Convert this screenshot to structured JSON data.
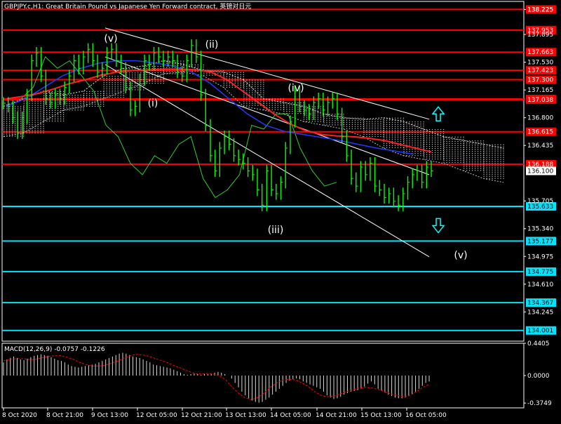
{
  "header": {
    "title": "GBPJPY.c,H1:  Great Britain Pound vs Japanese Yen Forward contract, 英镑对日元"
  },
  "macd": {
    "label": "MACD(12,26,9) -0.0757 -0.1226",
    "ticks": [
      "0.4405",
      "0.0000",
      "-0.3749"
    ]
  },
  "colors": {
    "background": "#000000",
    "price_bars": "#00ff00",
    "resistance": "#ff0000",
    "support": "#00e5ff",
    "ma_red": "#ff2020",
    "ma_blue": "#1e3cff",
    "chikou": "#33cc33",
    "channel": "#ffffff",
    "text": "#ffffff",
    "arrow": "#00ffff"
  },
  "chart_data": [
    {
      "type": "line",
      "title": "GBPJPY.c,H1:  Great Britain Pound vs Japanese Yen Forward contract, 英镑对日元",
      "x_ticks": [
        "8 Oct 2020",
        "8 Oct 21:00",
        "9 Oct 13:00",
        "12 Oct 05:00",
        "12 Oct 21:00",
        "13 Oct 13:00",
        "14 Oct 05:00",
        "14 Oct 21:00",
        "15 Oct 13:00",
        "16 Oct 05:00"
      ],
      "y_ticks": [
        138.225,
        137.895,
        137.53,
        137.165,
        136.8,
        136.435,
        135.705,
        135.34,
        134.975,
        134.61,
        134.245
      ],
      "ylim": [
        133.86,
        138.33
      ],
      "current_price": 136.1,
      "resistance_levels": [
        138.225,
        137.953,
        137.663,
        137.3,
        137.046,
        137.423,
        137.038,
        136.615,
        136.188
      ],
      "support_levels": [
        135.633,
        135.177,
        134.775,
        134.367,
        134.001
      ],
      "wave_labels": [
        "(v)",
        "(ii)",
        "(iv)",
        "(i)",
        "(iii)",
        "(v)"
      ],
      "price_series": [
        136.99,
        136.95,
        136.8,
        136.6,
        136.8,
        137.1,
        137.55,
        137.65,
        137.35,
        137.05,
        137.0,
        137.1,
        137.05,
        137.2,
        137.35,
        137.55,
        137.45,
        137.6,
        137.7,
        137.55,
        137.4,
        137.45,
        137.65,
        137.7,
        137.55,
        137.45,
        137.2,
        136.9,
        136.95,
        137.3,
        137.55,
        137.5,
        137.65,
        137.6,
        137.55,
        137.6,
        137.55,
        137.4,
        137.35,
        137.55,
        137.75,
        137.6,
        137.1,
        136.7,
        136.3,
        136.1,
        136.4,
        136.55,
        136.45,
        136.3,
        136.25,
        136.2,
        136.1,
        136.05,
        135.85,
        135.65,
        136.1,
        135.85,
        135.8,
        135.95,
        136.4,
        136.75,
        137.15,
        136.95,
        136.9,
        136.85,
        137.0,
        137.05,
        136.9,
        137.0,
        137.05,
        136.85,
        136.55,
        136.3,
        136.0,
        135.9,
        136.15,
        136.05,
        136.2,
        135.9,
        135.85,
        135.75,
        135.8,
        135.7,
        135.65,
        135.8,
        135.95,
        136.05,
        136.1,
        135.95,
        136.15,
        136.1
      ],
      "ma_red": [
        137.05,
        137.08,
        137.12,
        137.18,
        137.25,
        137.3,
        137.36,
        137.4,
        137.42,
        137.43,
        137.44,
        137.44,
        137.43,
        137.4,
        137.3,
        137.15,
        137.0,
        136.85,
        136.72,
        136.63,
        136.58,
        136.56,
        136.55,
        136.53,
        136.5,
        136.45,
        136.4,
        136.35
      ],
      "ma_blue": [
        136.95,
        137.05,
        137.2,
        137.35,
        137.45,
        137.52,
        137.55,
        137.55,
        137.52,
        137.48,
        137.4,
        137.25,
        137.05,
        136.85,
        136.7,
        136.62,
        136.58,
        136.54,
        136.5,
        136.45,
        136.4,
        136.36,
        136.32
      ],
      "chikou_series": [
        137.05,
        137.2,
        137.6,
        137.45,
        137.55,
        137.35,
        137.15,
        136.7,
        136.55,
        136.2,
        136.05,
        136.3,
        136.2,
        136.45,
        136.55,
        136.0,
        135.75,
        135.85,
        136.05,
        136.7,
        136.65,
        136.85,
        136.85,
        136.4,
        136.1,
        135.9,
        135.95
      ],
      "cloud_upper": [
        136.95,
        137.05,
        137.15,
        137.1,
        137.15,
        137.35,
        137.45,
        137.48,
        137.55,
        137.5,
        137.42,
        137.4,
        137.3,
        137.05,
        137.0,
        136.95,
        136.85,
        136.8,
        136.78,
        136.8,
        136.75,
        136.65,
        136.55,
        136.5,
        136.45,
        136.4
      ],
      "cloud_lower": [
        136.55,
        136.6,
        136.75,
        136.9,
        136.95,
        137.05,
        137.15,
        137.25,
        137.38,
        137.4,
        137.35,
        137.2,
        136.95,
        136.9,
        136.85,
        136.75,
        136.7,
        136.65,
        136.55,
        136.4,
        136.3,
        136.25,
        136.2,
        136.1,
        136.0,
        135.95
      ]
    },
    {
      "type": "bar",
      "title": "MACD(12,26,9) -0.0757 -0.1226",
      "ylim": [
        -0.4405,
        0.4405
      ],
      "macd_values": [
        0.18,
        0.22,
        0.24,
        0.26,
        0.24,
        0.22,
        0.21,
        0.23,
        0.25,
        0.27,
        0.28,
        0.29,
        0.28,
        0.27,
        0.25,
        0.23,
        0.21,
        0.2,
        0.18,
        0.15,
        0.13,
        0.12,
        0.11,
        0.12,
        0.13,
        0.14,
        0.15,
        0.16,
        0.18,
        0.2,
        0.22,
        0.24,
        0.26,
        0.28,
        0.3,
        0.31,
        0.3,
        0.28,
        0.26,
        0.25,
        0.24,
        0.22,
        0.2,
        0.18,
        0.15,
        0.14,
        0.13,
        0.12,
        0.11,
        0.1,
        0.08,
        0.06,
        0.04,
        0.02,
        0.01,
        0.02,
        0.03,
        0.02,
        0.01,
        0.02,
        0.02,
        0.03,
        0.04,
        0.05,
        0.04,
        0.02,
        0.0,
        -0.04,
        -0.1,
        -0.16,
        -0.22,
        -0.27,
        -0.31,
        -0.34,
        -0.36,
        -0.37,
        -0.36,
        -0.33,
        -0.3,
        -0.26,
        -0.22,
        -0.18,
        -0.14,
        -0.1,
        -0.07,
        -0.05,
        -0.04,
        -0.05,
        -0.08,
        -0.1,
        -0.12,
        -0.14,
        -0.16,
        -0.18,
        -0.22,
        -0.27,
        -0.3,
        -0.32,
        -0.31,
        -0.29,
        -0.26,
        -0.24,
        -0.22,
        -0.21,
        -0.2,
        -0.18,
        -0.15,
        -0.11,
        -0.08,
        -0.12,
        -0.18,
        -0.21,
        -0.23,
        -0.26,
        -0.28,
        -0.3,
        -0.31,
        -0.31,
        -0.3,
        -0.28,
        -0.25,
        -0.22,
        -0.18,
        -0.14,
        -0.1,
        -0.08
      ],
      "signal_values": [
        0.2,
        0.22,
        0.23,
        0.23,
        0.22,
        0.22,
        0.24,
        0.26,
        0.27,
        0.27,
        0.25,
        0.22,
        0.18,
        0.15,
        0.13,
        0.13,
        0.14,
        0.17,
        0.2,
        0.24,
        0.27,
        0.29,
        0.28,
        0.26,
        0.23,
        0.2,
        0.17,
        0.13,
        0.1,
        0.06,
        0.03,
        0.02,
        0.03,
        0.02,
        0.0,
        -0.06,
        -0.16,
        -0.24,
        -0.3,
        -0.33,
        -0.3,
        -0.24,
        -0.16,
        -0.1,
        -0.06,
        -0.05,
        -0.06,
        -0.1,
        -0.15,
        -0.22,
        -0.27,
        -0.29,
        -0.28,
        -0.25,
        -0.22,
        -0.19,
        -0.17,
        -0.16,
        -0.17,
        -0.19,
        -0.22,
        -0.25,
        -0.27,
        -0.29,
        -0.27,
        -0.22,
        -0.16,
        -0.12
      ]
    }
  ]
}
